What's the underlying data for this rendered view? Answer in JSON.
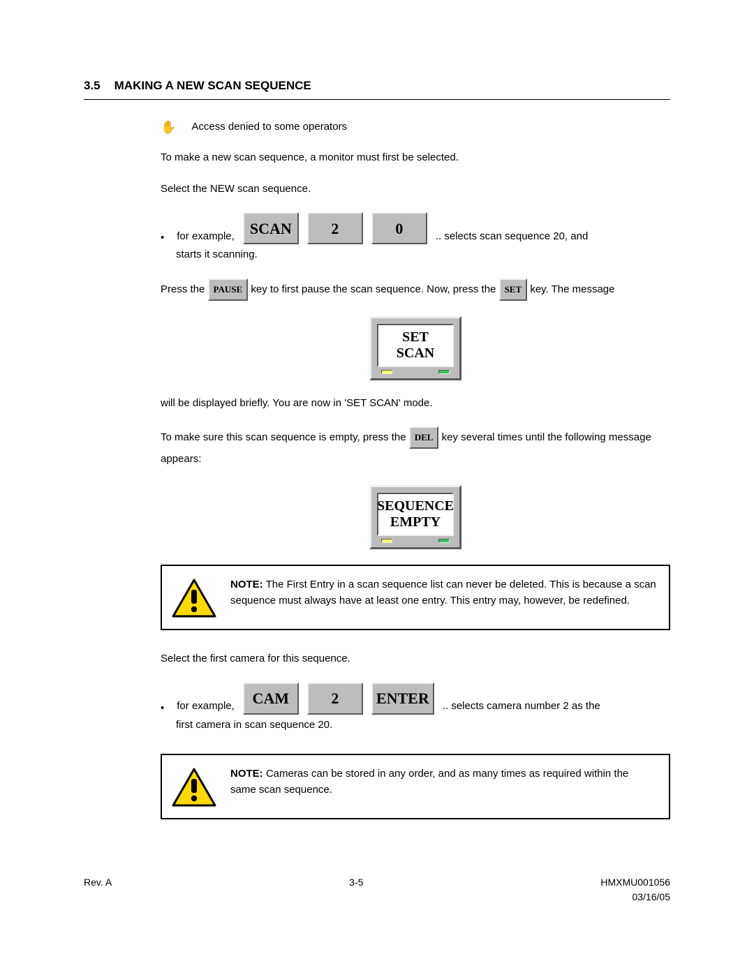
{
  "section": {
    "number": "3.5",
    "title": "MAKING A NEW SCAN SEQUENCE"
  },
  "access_note": "Access denied to some operators",
  "p1": "To make a new scan sequence, a monitor must first be selected.",
  "p2": "Select the NEW scan sequence.",
  "example1": {
    "before": "for example,",
    "keys": {
      "k1": "SCAN",
      "k2": "2",
      "k3": "0"
    },
    "after": ".. selects scan sequence 20, and",
    "after_wrap": "starts it scanning."
  },
  "p3": {
    "t1": "Press the ",
    "key1": "PAUSE",
    "t2": " key to first pause the scan sequence.  Now, press the ",
    "key2": "SET",
    "t3": " key.  The message"
  },
  "monitor1": {
    "line1": "SET",
    "line2": "SCAN"
  },
  "p4": "will be displayed briefly.  You are now in 'SET SCAN' mode.",
  "p5": {
    "t1": "To make sure this scan sequence is empty, press the ",
    "key": "DEL",
    "t2": " key several times until the following message appears:"
  },
  "monitor2": {
    "line1": "SEQUENCE",
    "line2": "EMPTY"
  },
  "note1": {
    "label": "NOTE:",
    "body": "  The First Entry in a scan sequence list can never be deleted.  This is because a scan sequence must always have at least one entry.  This entry may, however, be redefined."
  },
  "p6": "Select the first camera for this sequence.",
  "example2": {
    "before": "for example,",
    "keys": {
      "k1": "CAM",
      "k2": "2",
      "k3": "ENTER"
    },
    "after": ".. selects camera number 2 as the",
    "after_wrap": "first camera in scan sequence 20."
  },
  "note2": {
    "label": "NOTE:",
    "body": "  Cameras can be stored in any order, and as many times as required within the same scan sequence."
  },
  "footer": {
    "left": "Rev. A",
    "center": "3-5",
    "right_doc": "HMXMU001056",
    "right_date": "03/16/05"
  }
}
